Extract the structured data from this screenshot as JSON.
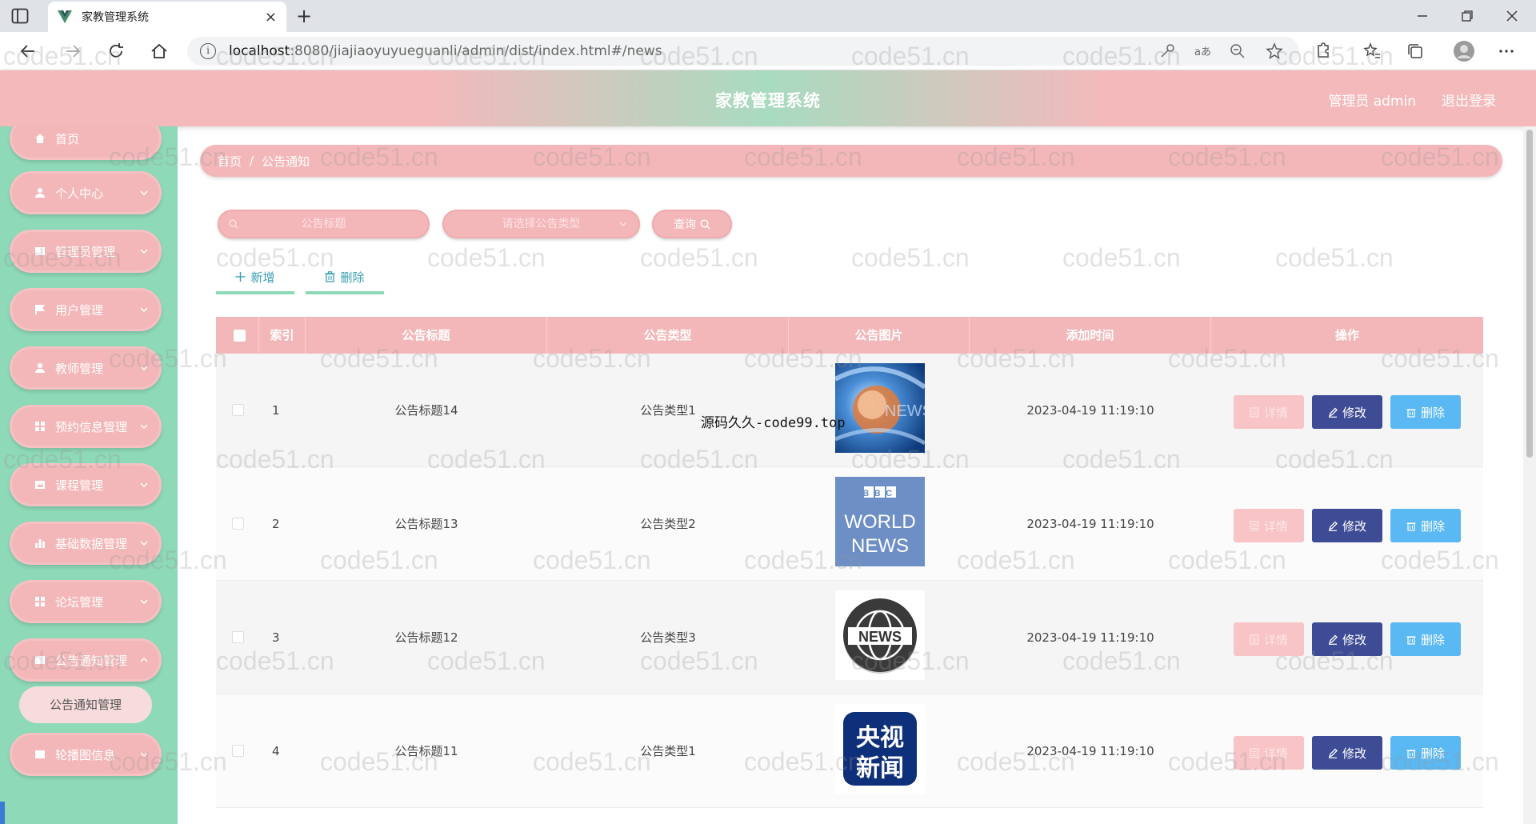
{
  "browser": {
    "tab_title": "家教管理系统",
    "url_host": "localhost",
    "url_path": ":8080/jiajiaoyuyueguanli/admin/dist/index.html#/news",
    "new_tab_label": "+",
    "tab_close_label": "×"
  },
  "header": {
    "title": "家教管理系统",
    "user_label": "管理员 admin",
    "logout_label": "退出登录"
  },
  "sidebar": {
    "items": [
      {
        "label": "首页",
        "icon": "home-icon",
        "has_children": false
      },
      {
        "label": "个人中心",
        "icon": "user-icon",
        "has_children": true
      },
      {
        "label": "管理员管理",
        "icon": "folder-icon",
        "has_children": true
      },
      {
        "label": "用户管理",
        "icon": "flag-icon",
        "has_children": true
      },
      {
        "label": "教师管理",
        "icon": "user-icon",
        "has_children": true
      },
      {
        "label": "预约信息管理",
        "icon": "grid-icon",
        "has_children": true
      },
      {
        "label": "课程管理",
        "icon": "image-icon",
        "has_children": true
      },
      {
        "label": "基础数据管理",
        "icon": "bar-chart-icon",
        "has_children": true
      },
      {
        "label": "论坛管理",
        "icon": "grid-icon",
        "has_children": true
      },
      {
        "label": "公告通知管理",
        "icon": "folder-icon",
        "has_children": true
      },
      {
        "label": "轮播图信息",
        "icon": "folder-icon",
        "has_children": true
      }
    ],
    "active_sub": "公告通知管理"
  },
  "breadcrumb": {
    "home": "首页",
    "separator": "/",
    "current": "公告通知"
  },
  "search": {
    "title_placeholder": "公告标题",
    "type_placeholder": "请选择公告类型",
    "query_label": "查询"
  },
  "toolbar": {
    "add_label": "新增",
    "delete_label": "删除"
  },
  "table": {
    "columns": [
      "索引",
      "公告标题",
      "公告类型",
      "公告图片",
      "添加时间",
      "操作"
    ],
    "rows": [
      {
        "index": "1",
        "title": "公告标题14",
        "type": "公告类型1",
        "image": "news-globe-image",
        "time": "2023-04-19 11:19:10"
      },
      {
        "index": "2",
        "title": "公告标题13",
        "type": "公告类型2",
        "image": "bbc-world-news-image",
        "time": "2023-04-19 11:19:10"
      },
      {
        "index": "3",
        "title": "公告标题12",
        "type": "公告类型3",
        "image": "news-globe-badge-image",
        "time": "2023-04-19 11:19:10"
      },
      {
        "index": "4",
        "title": "公告标题11",
        "type": "公告类型1",
        "image": "cctv-news-image",
        "time": "2023-04-19 11:19:10"
      }
    ],
    "actions": {
      "detail": "详情",
      "edit": "修改",
      "delete": "删除"
    }
  },
  "images": {
    "bbc_lines": [
      "BBC",
      "WORLD",
      "NEWS"
    ],
    "news_badge": "NEWS",
    "cctv_lines": [
      "央视",
      "新闻"
    ]
  },
  "overlay_text": "源码久久-code99.top",
  "watermark_text": "code51.cn",
  "colors": {
    "pink": "#f4b7b9",
    "mint": "#8ed9b8",
    "edit_button": "#3e4c96",
    "delete_button": "#5ab8f2"
  }
}
